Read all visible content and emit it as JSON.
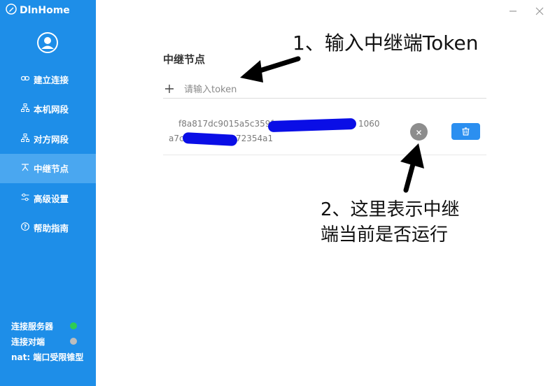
{
  "app": {
    "title": "DlnHome"
  },
  "sidebar": {
    "items": [
      {
        "label": "建立连接",
        "icon": "link-icon"
      },
      {
        "label": "本机网段",
        "icon": "network-icon"
      },
      {
        "label": "对方网段",
        "icon": "network-icon"
      },
      {
        "label": "中继节点",
        "icon": "relay-icon",
        "active": true
      },
      {
        "label": "高级设置",
        "icon": "sliders-icon"
      },
      {
        "label": "帮助指南",
        "icon": "help-icon"
      }
    ],
    "status": [
      {
        "label": "连接服务器",
        "color": "#2ecc55"
      },
      {
        "label": "连接对端",
        "color": "#bdbdbd"
      }
    ],
    "nat_text": "nat: 端口受限锥型"
  },
  "main": {
    "section_title": "中继节点",
    "token_input": {
      "placeholder": "请输入token",
      "value": ""
    },
    "relay": {
      "token_line1": "f8a817dc9015a5c359fe",
      "token_line1_end": "1060",
      "token_line2_start": "a7c",
      "token_line2_end": "72354a1",
      "status_color": "#8d8d8d"
    }
  },
  "annotations": {
    "step1": "1、输入中继端Token",
    "step2_line1": "2、这里表示中继",
    "step2_line2": "端当前是否运行"
  },
  "colors": {
    "sidebar_bg": "#1e8ee8",
    "active_bg": "#4aa7f0",
    "primary_button": "#2b8ff0"
  }
}
